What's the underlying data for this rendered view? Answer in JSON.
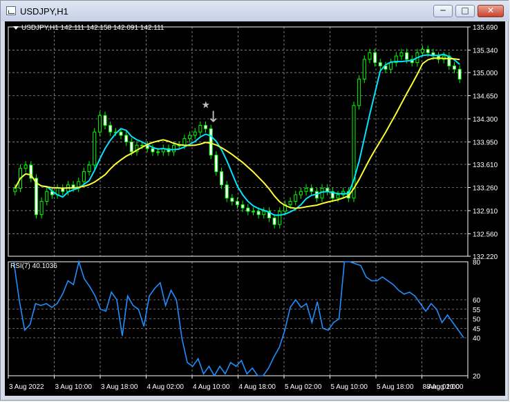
{
  "window": {
    "title": "USDJPY,H1",
    "min_label": "─",
    "max_label": "□",
    "close_label": "✕",
    "icons": {
      "app": "chart-window-icon",
      "minimize": "minimize-icon",
      "maximize": "maximize-icon",
      "close": "close-icon"
    }
  },
  "chart": {
    "ohlc_label": "USDJPY,H1  142.111 142.158 142.091 142.111",
    "rsi_label": "RSI(7) 40.1036",
    "price_ticks": [
      "135.690",
      "135.340",
      "135.000",
      "134.650",
      "134.300",
      "133.950",
      "133.610",
      "133.260",
      "132.910",
      "132.560",
      "132.220"
    ],
    "rsi_ticks": [
      "80",
      "60",
      "55",
      "50",
      "45",
      "40",
      "20"
    ],
    "time_ticks": [
      "3 Aug 2022",
      "3 Aug 10:00",
      "3 Aug 18:00",
      "4 Aug 02:00",
      "4 Aug 10:00",
      "4 Aug 18:00",
      "5 Aug 02:00",
      "5 Aug 10:00",
      "5 Aug 18:00",
      "8 Aug 02:00",
      "8 Aug 10:00"
    ],
    "colors": {
      "bg": "#000000",
      "grid": "#ffffff",
      "candle": "#00ff00",
      "ma_fast": "#00e5ff",
      "ma_slow": "#ffff33",
      "rsi": "#1e90ff",
      "arrow": "#c0c0c0"
    },
    "markers": {
      "star": "★",
      "arrow": "↓"
    }
  },
  "chart_data": {
    "type": "line",
    "symbol": "USDJPY",
    "timeframe": "H1",
    "price_ylim": [
      132.22,
      135.69
    ],
    "rsi_ylim": [
      20,
      80
    ],
    "close": [
      133.25,
      133.55,
      133.6,
      133.4,
      132.85,
      133.05,
      133.2,
      133.15,
      133.25,
      133.2,
      133.3,
      133.25,
      133.35,
      133.5,
      133.6,
      134.1,
      134.35,
      134.2,
      134.1,
      134.1,
      134.05,
      133.95,
      133.8,
      133.9,
      133.9,
      133.85,
      133.8,
      133.8,
      133.85,
      133.8,
      133.9,
      133.9,
      134.0,
      134.05,
      134.1,
      134.2,
      134.15,
      133.75,
      133.5,
      133.3,
      133.1,
      133.05,
      133.0,
      132.95,
      132.9,
      132.9,
      132.85,
      132.9,
      132.8,
      132.7,
      132.9,
      133.0,
      133.05,
      133.15,
      133.2,
      133.25,
      133.2,
      133.1,
      133.25,
      133.2,
      133.1,
      133.15,
      133.2,
      133.1,
      134.5,
      134.9,
      135.2,
      135.3,
      135.15,
      135.1,
      135.05,
      135.15,
      135.25,
      135.3,
      135.2,
      135.15,
      135.3,
      135.35,
      135.3,
      135.25,
      135.2,
      135.25,
      135.1,
      135.05,
      134.9
    ],
    "rsi": [
      80,
      60,
      44,
      47,
      58,
      57,
      58,
      56,
      58,
      63,
      70,
      68,
      82,
      71,
      67,
      62,
      55,
      54,
      64,
      60,
      41,
      62,
      57,
      55,
      46,
      62,
      66,
      69,
      57,
      65,
      60,
      40,
      27,
      25,
      29,
      21,
      25,
      20,
      25,
      21,
      27,
      25,
      28,
      21,
      24,
      20,
      20,
      24,
      30,
      35,
      44,
      56,
      60,
      56,
      58,
      48,
      59,
      45,
      44,
      48,
      50,
      82,
      80,
      79,
      78,
      72,
      70,
      70,
      72,
      70,
      68,
      65,
      63,
      64,
      62,
      58,
      54,
      58,
      55,
      48,
      52,
      48,
      44,
      40
    ]
  }
}
